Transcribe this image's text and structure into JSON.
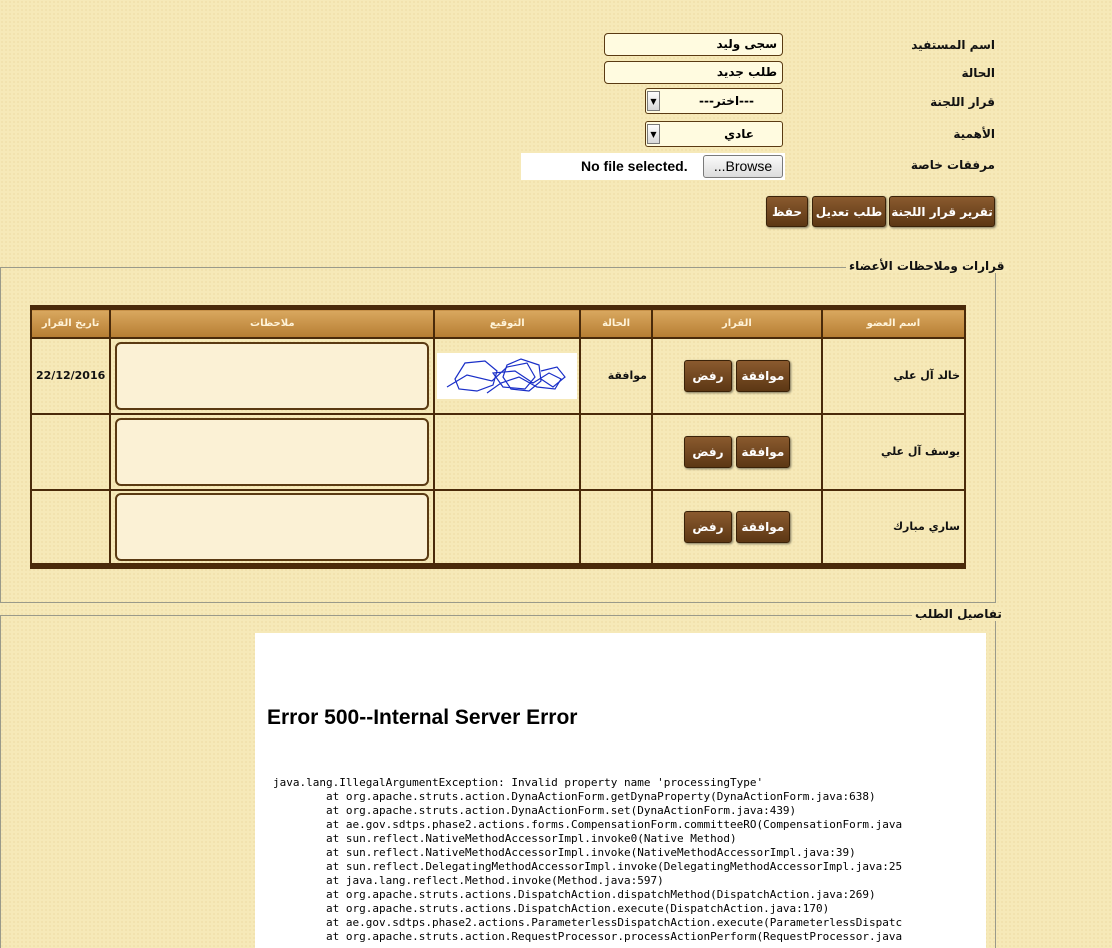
{
  "form": {
    "beneficiary_label": "اسم المستفيد",
    "beneficiary_value": "سجى وليد",
    "status_label": "الحالة",
    "status_value": "طلب جديد",
    "committee_decision_label": "قرار اللجنة",
    "committee_decision_value": "---اختر---",
    "importance_label": "الأهمية",
    "importance_value": "عادي",
    "attachments_label": "مرفقات خاصة",
    "file_status": "No file selected.",
    "browse_label": "...Browse"
  },
  "actions": {
    "report_label": "تقرير قرار اللجنة",
    "edit_request_label": "طلب تعديل",
    "save_label": "حفظ"
  },
  "decisions_section": {
    "legend": "قرارات وملاحظات الأعضاء",
    "columns": [
      "اسم العضو",
      "القرار",
      "الحالة",
      "التوقيع",
      "ملاحظات",
      "تاريخ القرار"
    ],
    "approve_label": "موافقة",
    "reject_label": "رفض",
    "rows": [
      {
        "member": "خالد آل علي",
        "status": "موافقة",
        "date": "22/12/2016",
        "signed": true
      },
      {
        "member": "يوسف آل علي",
        "status": "",
        "date": "",
        "signed": false
      },
      {
        "member": "ساري مبارك",
        "status": "",
        "date": "",
        "signed": false
      }
    ]
  },
  "details_section": {
    "legend": "تفاصيل الطلب",
    "error_title": "Error 500--Internal Server Error",
    "stack_trace": [
      "java.lang.IllegalArgumentException: Invalid property name 'processingType'",
      "        at org.apache.struts.action.DynaActionForm.getDynaProperty(DynaActionForm.java:638)",
      "        at org.apache.struts.action.DynaActionForm.set(DynaActionForm.java:439)",
      "        at ae.gov.sdtps.phase2.actions.forms.CompensationForm.committeeRO(CompensationForm.java",
      "        at sun.reflect.NativeMethodAccessorImpl.invoke0(Native Method)",
      "        at sun.reflect.NativeMethodAccessorImpl.invoke(NativeMethodAccessorImpl.java:39)",
      "        at sun.reflect.DelegatingMethodAccessorImpl.invoke(DelegatingMethodAccessorImpl.java:25",
      "        at java.lang.reflect.Method.invoke(Method.java:597)",
      "        at org.apache.struts.actions.DispatchAction.dispatchMethod(DispatchAction.java:269)",
      "        at org.apache.struts.actions.DispatchAction.execute(DispatchAction.java:170)",
      "        at ae.gov.sdtps.phase2.actions.ParameterlessDispatchAction.execute(ParameterlessDispatc",
      "        at org.apache.struts.action.RequestProcessor.processActionPerform(RequestProcessor.java"
    ]
  },
  "colors": {
    "page_background": "#f6e9b8",
    "button_brown": "#6b4420",
    "header_tan": "#c58f45",
    "border_dark": "#4a2a0a",
    "signature_blue": "#1a2fc8"
  }
}
